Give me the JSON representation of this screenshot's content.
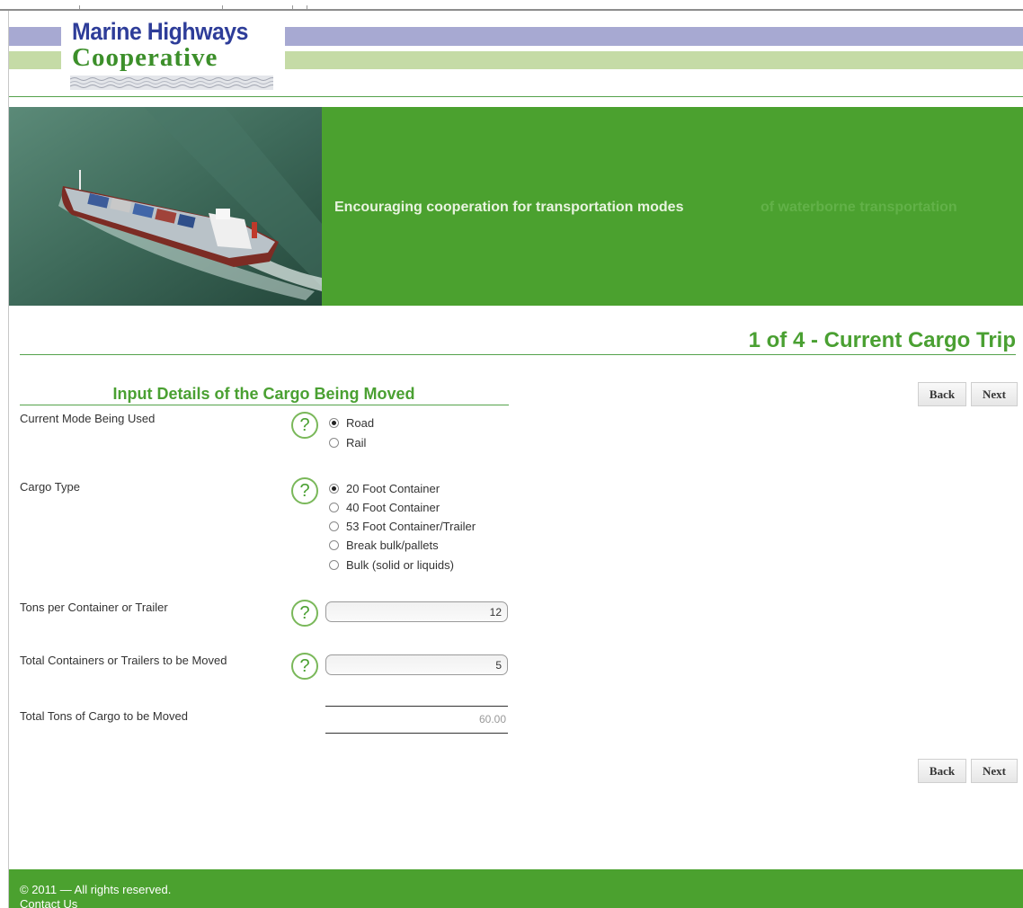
{
  "brand": {
    "name_line1": "Marine Highways",
    "name_line2": "Cooperative",
    "colors": {
      "primary_green": "#4ba12f",
      "title_green": "#4aa032",
      "logo_blue": "#2e3d99",
      "stripe_purple": "#a7a9d2",
      "stripe_green": "#c5dba6"
    }
  },
  "banner": {
    "tagline": "Encouraging cooperation for transportation modes",
    "tagline_faded": "of waterborne transportation",
    "image": "cargo-ship-photo"
  },
  "page": {
    "title": "1 of 4 - Current Cargo Trip",
    "section_heading": "Input Details of the Cargo Being Moved"
  },
  "nav": {
    "back_label": "Back",
    "next_label": "Next"
  },
  "form": {
    "mode": {
      "label": "Current Mode Being Used",
      "options": [
        {
          "label": "Road",
          "selected": true
        },
        {
          "label": "Rail",
          "selected": false
        }
      ]
    },
    "cargo_type": {
      "label": "Cargo Type",
      "options": [
        {
          "label": "20 Foot Container",
          "selected": true
        },
        {
          "label": "40 Foot Container",
          "selected": false
        },
        {
          "label": "53 Foot Container/Trailer",
          "selected": false
        },
        {
          "label": "Break bulk/pallets",
          "selected": false
        },
        {
          "label": "Bulk (solid or liquids)",
          "selected": false
        }
      ]
    },
    "tons_per_container": {
      "label": "Tons per Container or Trailer",
      "value": "12"
    },
    "total_containers": {
      "label": "Total Containers or Trailers to be Moved",
      "value": "5"
    },
    "total_tons": {
      "label": "Total Tons of Cargo to be Moved",
      "value": "60.00"
    }
  },
  "help": {
    "glyph": "?",
    "icon": "help-question-icon"
  },
  "footer": {
    "copyright": "© 2011 — All rights reserved.",
    "contact_label": "Contact Us"
  }
}
